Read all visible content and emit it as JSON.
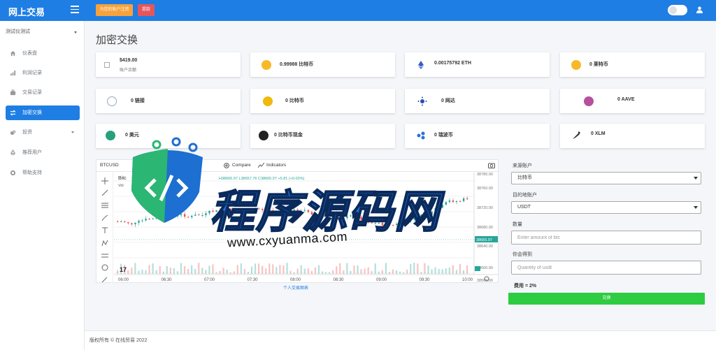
{
  "brand": "网上交易",
  "header": {
    "upgrade_button": "为您的账户注资",
    "withdraw_button": "提款"
  },
  "sidebar": {
    "account_select": "测试仪测试",
    "items": [
      {
        "label": "仪表盘",
        "icon": "home-icon"
      },
      {
        "label": "利润记录",
        "icon": "bar-chart-icon"
      },
      {
        "label": "交易记录",
        "icon": "briefcase-icon"
      },
      {
        "label": "加密交换",
        "icon": "exchange-icon"
      },
      {
        "label": "投资",
        "icon": "coins-icon"
      },
      {
        "label": "推荐用户",
        "icon": "recycle-icon"
      },
      {
        "label": "帮助支持",
        "icon": "lifebuoy-icon"
      }
    ]
  },
  "page_title": "加密交换",
  "cards": [
    {
      "label": "$419.00",
      "sub": "账户余额",
      "icon": "image-icon",
      "color": "#ffffff"
    },
    {
      "label": "0.99988 比特币",
      "icon": "bitcoin-icon",
      "color": "#f7b928"
    },
    {
      "label": "0.00175792 ETH",
      "icon": "ethereum-icon",
      "color": "#3c5cc5"
    },
    {
      "label": "0 莱特币",
      "icon": "litecoin-icon",
      "color": "#f7b928"
    },
    {
      "label": "0 链接",
      "icon": "chainlink-icon",
      "color": "#c8d4e8"
    },
    {
      "label": "0 比特币",
      "icon": "bitcoin-cash-icon",
      "color": "#f0b90b"
    },
    {
      "label": "0 网达",
      "icon": "cardano-icon",
      "color": "#2a4fb0"
    },
    {
      "label": "0 AAVE",
      "icon": "aave-icon",
      "color": "#b6509e"
    },
    {
      "label": "0 美元",
      "icon": "tether-icon",
      "color": "#26a17b"
    },
    {
      "label": "0 比特币现金",
      "icon": "bitcoin-sv-icon",
      "color": "#222222"
    },
    {
      "label": "0 瑞波币",
      "icon": "ripple-icon",
      "color": "#2a6fdb"
    },
    {
      "label": "0 XLM",
      "icon": "stellar-icon",
      "color": "#222222"
    }
  ],
  "chart": {
    "symbol": "BTCUSD",
    "compare_label": "Compare",
    "indicators_label": "Indicators",
    "legend_title": "Bitc",
    "ohlc_text": "H38665.97 L38657.76 C38665.97 +5.81 (+0.02%)",
    "vol_label": "Vol",
    "current_price": "38665.97",
    "price_ticks": [
      "38780.00",
      "38760.00",
      "38720.00",
      "38680.00",
      "38640.00",
      "38600.00",
      "38560.00"
    ],
    "time_ticks": [
      "06:00",
      "06:30",
      "07:00",
      "07:30",
      "08:00",
      "08:30",
      "09:00",
      "09:30",
      "10:00"
    ],
    "caption": "个人交易图表"
  },
  "form": {
    "source_label": "来源账户",
    "source_value": "比特币",
    "target_label": "目的地账户",
    "target_value": "USDT",
    "amount_label": "数量",
    "amount_placeholder": "Enter amount of btc",
    "receive_label": "你会得到",
    "receive_placeholder": "Quantity of usdt",
    "fee_text": "费用 = 2%",
    "submit_label": "交换"
  },
  "footer": "版权所有 © 在线贸易 2022",
  "watermark": {
    "title": "程序源码网",
    "url": "www.cxyuanma.com"
  },
  "colors": {
    "primary": "#1f7ee3",
    "success": "#2ecc40",
    "candle_up": "#26a69a",
    "candle_down": "#ef5350"
  }
}
